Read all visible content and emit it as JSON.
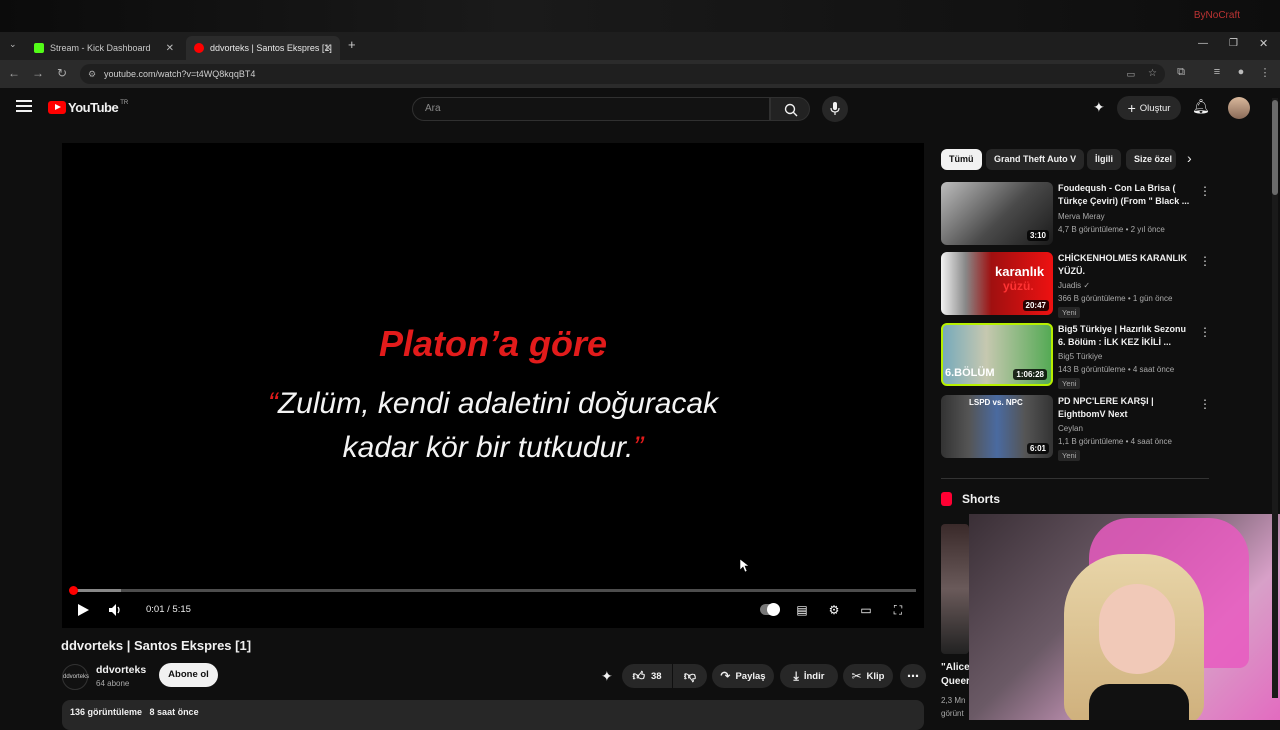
{
  "browser": {
    "corner_logo": "ByNoCraft",
    "tabs": [
      {
        "label": "Stream - Kick Dashboard",
        "active": false,
        "favicon_color": "#53fc18"
      },
      {
        "label": "ddvorteks | Santos Ekspres [1]",
        "active": true,
        "favicon_color": "#ff0000"
      }
    ],
    "url": "youtube.com/watch?v=t4WQ8kqqBT4"
  },
  "youtube": {
    "logo_text": "YouTube",
    "country": "TR",
    "search_placeholder": "Ara",
    "create_label": "Oluştur"
  },
  "video": {
    "quote_title": "Platon’a göre",
    "quote_open": "“",
    "quote_line1": "Zulüm, kendi adaletini doğuracak",
    "quote_line2": "kadar kör bir tutkudur.",
    "quote_close": "”",
    "time": "0:01 / 5:15",
    "progress_fraction": 0.0032,
    "buffer_fraction": 0.06,
    "title": "ddvorteks | Santos Ekspres [1]",
    "channel": "ddvorteks",
    "channel_avatar_text": "ddvorteks",
    "subscribers": "64 abone",
    "subscribe_label": "Abone ol",
    "likes": "38",
    "share_label": "Paylaş",
    "download_label": "İndir",
    "clip_label": "Klip",
    "views": "136 görüntüleme",
    "uploaded": "8 saat önce"
  },
  "chips": [
    {
      "label": "Tümü",
      "active": true
    },
    {
      "label": "Grand Theft Auto V",
      "active": false
    },
    {
      "label": "İlgili",
      "active": false
    },
    {
      "label": "Size özel",
      "active": false
    }
  ],
  "recommendations": [
    {
      "title": "Foudeqush -  Con La Brisa ( Türkçe Çeviri) (From \" Black ...",
      "channel": "Merva Meray",
      "meta": "4,7 B görüntüleme • 2 yıl önce",
      "duration": "3:10",
      "badge": ""
    },
    {
      "title": "CHİCKENHOLMES KARANLIK YÜZÜ.",
      "channel": "Juadis ✓",
      "meta": "366 B görüntüleme • 1 gün önce",
      "duration": "20:47",
      "badge": "Yeni"
    },
    {
      "title": "Big5 Türkiye | Hazırlık Sezonu 6. Bölüm : İLK KEZ İKİLİ ...",
      "channel": "Big5 Türkiye",
      "meta": "143 B görüntüleme • 4 saat önce",
      "duration": "1:06:28",
      "badge": "Yeni"
    },
    {
      "title": "PD NPC'LERE KARŞI | EightbomV Next",
      "channel": "Ceylan",
      "meta": "1,1 B görüntüleme • 4 saat önce",
      "duration": "6:01",
      "badge": "Yeni"
    }
  ],
  "thumb_texts": {
    "karanlik": "karanlık",
    "yuzu": "yüzü.",
    "bolum": "6.BÖLÜM",
    "lspd": "LSPD vs. NPC"
  },
  "shorts": {
    "heading": "Shorts",
    "first_title_line1": "\"Alice",
    "first_title_line2": "Queer",
    "first_views_line1": "2,3 Mn",
    "first_views_line2": "görünt"
  },
  "colors": {
    "accent": "#ff0000",
    "background": "#0f0f0f",
    "quote_red": "#e21b1b"
  }
}
